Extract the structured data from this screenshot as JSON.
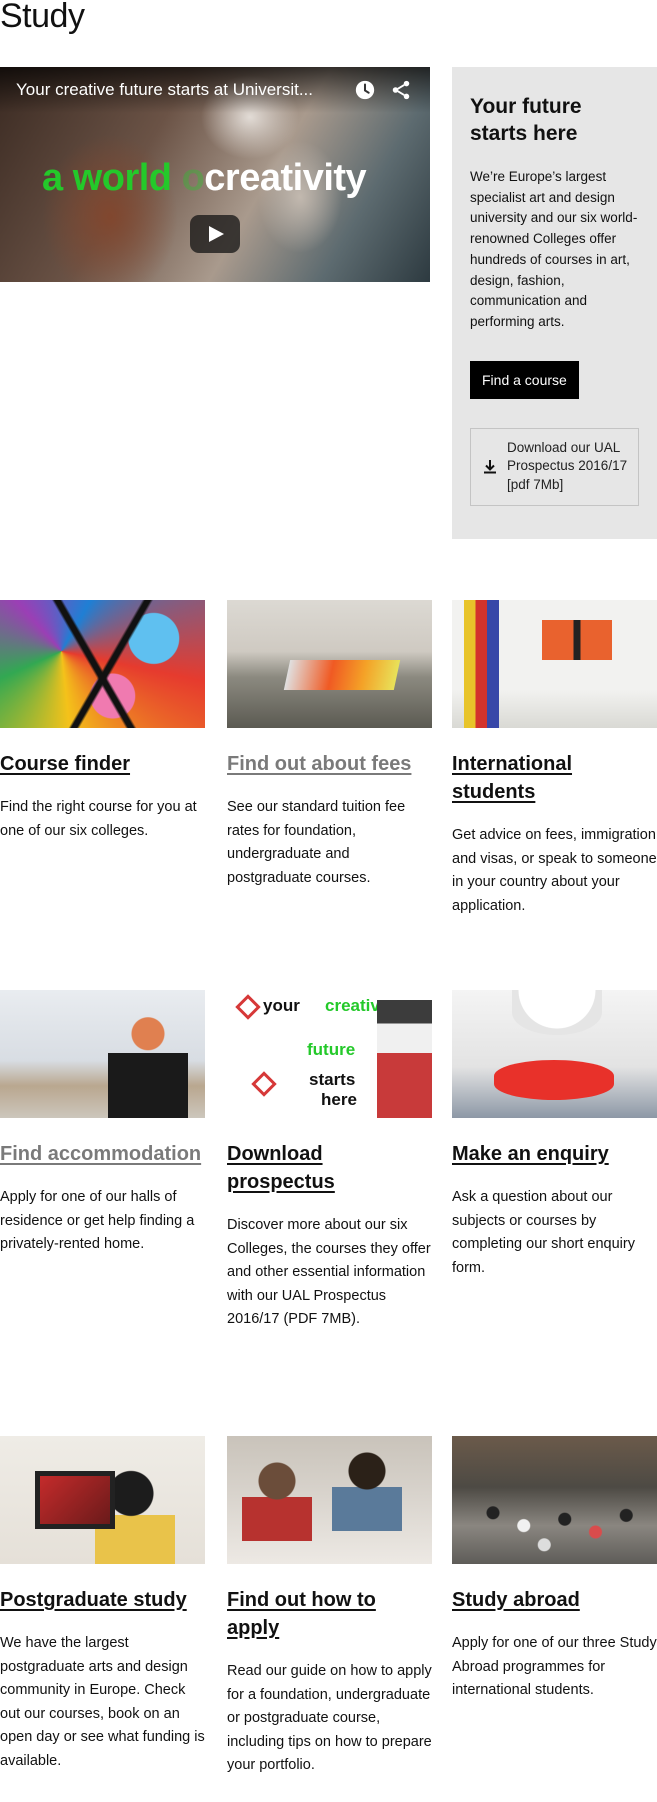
{
  "page": {
    "title": "Study"
  },
  "video": {
    "title": "Your creative future starts at Universit...",
    "overlay_green_1": "a world ",
    "overlay_green_2": "o",
    "overlay_white": "creativity"
  },
  "panel": {
    "heading": "Your future starts here",
    "body": "We’re Europe’s largest specialist art and design university and our six world-renowned Colleges offer hundreds of courses in art, design, fashion, communication and performing arts.",
    "find_button": "Find a course",
    "download_label": "Download our UAL Prospectus 2016/17 [pdf 7Mb]"
  },
  "cards": [
    {
      "title": "Course finder",
      "text": "Find the right course for you at one of our six colleges."
    },
    {
      "title": "Find out about fees",
      "text": "See our standard tuition fee rates for foundation, undergraduate and postgraduate courses."
    },
    {
      "title": "International students",
      "text": "Get advice on fees, immigration and visas, or speak to someone in your country about your application."
    },
    {
      "title": "Find accommodation",
      "text": "Apply for one of our halls of residence or get help finding a privately-rented home."
    },
    {
      "title": "Download prospectus",
      "text": "Discover more about our six Colleges, the courses they offer and other essential information with our UAL Prospectus 2016/17 (PDF 7MB)."
    },
    {
      "title": "Make an enquiry",
      "text": "Ask a question about our subjects or courses by completing our short enquiry form."
    },
    {
      "title": "Postgraduate study",
      "text": "We have the largest postgraduate arts and design community in Europe. Check out our courses, book on an open day or see what funding is available."
    },
    {
      "title": "Find out how to apply",
      "text": "Read our guide on how to apply for a foundation, undergraduate or postgraduate course, including tips on how to prepare your portfolio."
    },
    {
      "title": "Study abroad",
      "text": "Apply for one of our three Study Abroad programmes for international students."
    }
  ],
  "prospectus_thumb": {
    "word_your": "your",
    "word_creative": "creative",
    "word_future": "future",
    "word_starts": "starts",
    "word_here": "here"
  },
  "colors": {
    "accent_green": "#24c92a",
    "panel_bg": "#e6e6e6",
    "button_bg": "#000000",
    "muted_link": "#7a7a7a"
  },
  "icons": [
    "clock-icon",
    "share-icon",
    "play-icon",
    "download-icon"
  ]
}
